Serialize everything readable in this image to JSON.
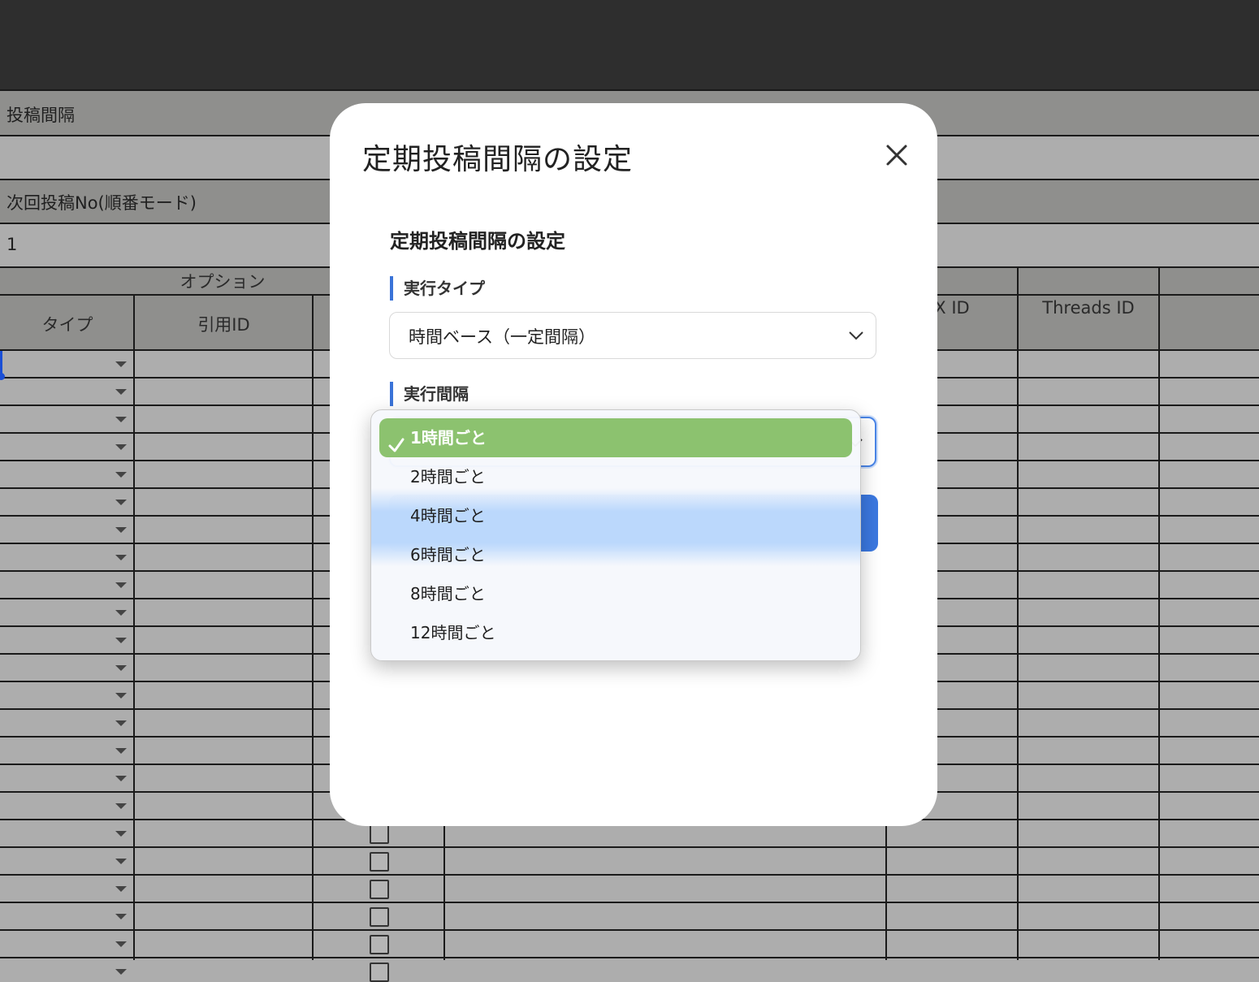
{
  "sheet": {
    "row_interval_label": "投稿間隔",
    "row_next_label": "次回投稿No(順番モード)",
    "row_next_value": "1",
    "group_header": "オプション",
    "col_type": "タイプ",
    "col_quote_id": "引用ID",
    "col_x_id": "X ID",
    "col_threads_id": "Threads ID"
  },
  "modal": {
    "title": "定期投稿間隔の設定",
    "card_title": "定期投稿間隔の設定",
    "run_type_label": "実行タイプ",
    "run_type_value": "時間ベース（一定間隔）",
    "interval_label": "実行間隔",
    "close_icon": "close-icon"
  },
  "dropdown": {
    "options": [
      "1時間ごと",
      "2時間ごと",
      "4時間ごと",
      "6時間ごと",
      "8時間ごと",
      "12時間ごと"
    ],
    "selected_index": 0,
    "accent_color": "#8cc26f"
  },
  "colors": {
    "top_bar": "#2e2e2e",
    "sheet_bg": "#adadad",
    "header_band": "#8f8f8d",
    "primary_button": "#3b78e0"
  }
}
